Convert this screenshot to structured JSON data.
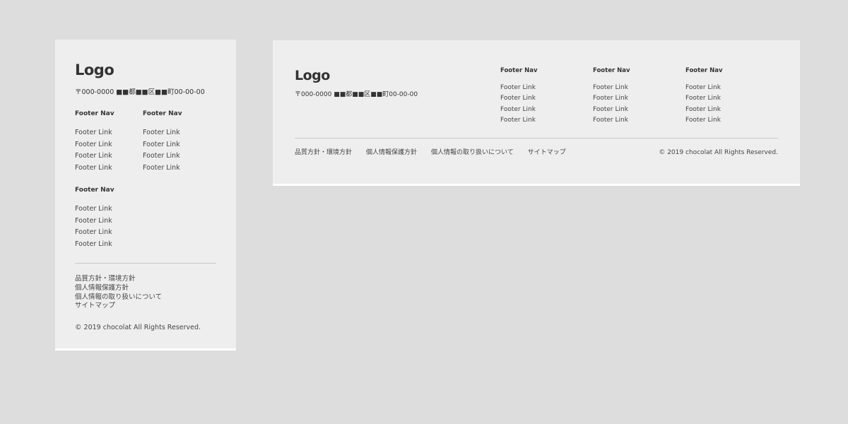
{
  "logo": "Logo",
  "address": "〒000-0000 ■■都■■区■■町00-00-00",
  "nav_columns": [
    {
      "title": "Footer Nav",
      "links": [
        "Footer Link",
        "Footer Link",
        "Footer Link",
        "Footer Link"
      ]
    },
    {
      "title": "Footer Nav",
      "links": [
        "Footer Link",
        "Footer Link",
        "Footer Link",
        "Footer Link"
      ]
    },
    {
      "title": "Footer Nav",
      "links": [
        "Footer Link",
        "Footer Link",
        "Footer Link",
        "Footer Link"
      ]
    }
  ],
  "policy_links": [
    "品質方針・環境方針",
    "個人情報保護方針",
    "個人情報の取り扱いについて",
    "サイトマップ"
  ],
  "copyright": "© 2019 chocolat All Rights Reserved.",
  "colors": {
    "background": "#dddddd",
    "card": "#eeeeee",
    "text": "#333333",
    "divider": "#c8c8c8"
  }
}
